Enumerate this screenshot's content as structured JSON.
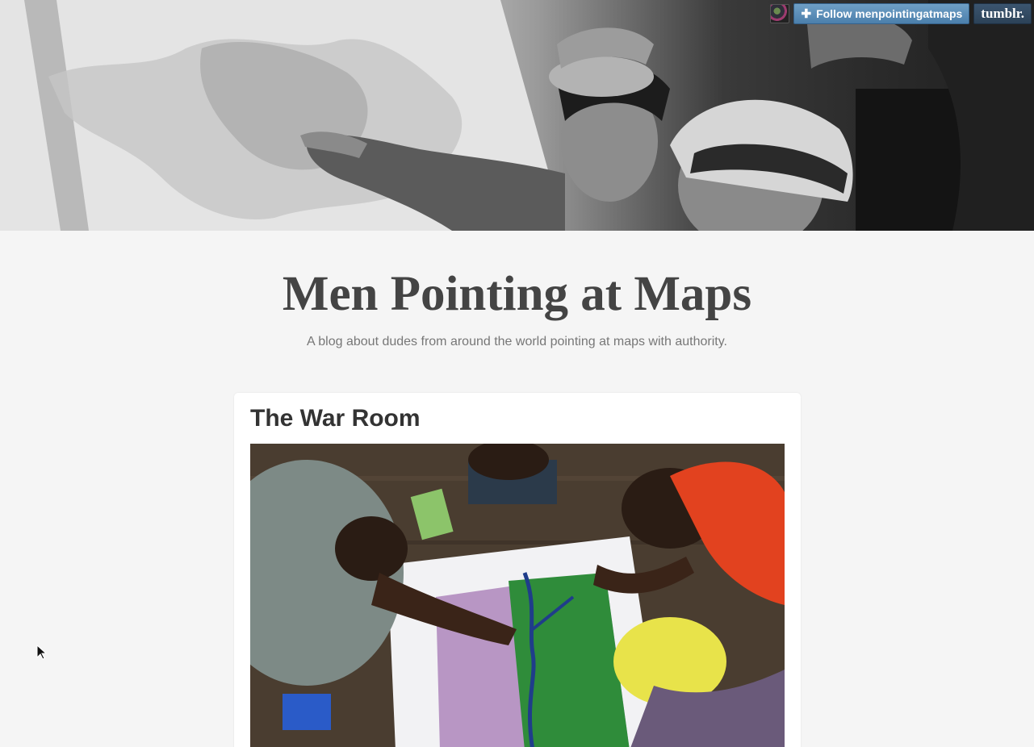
{
  "header": {
    "follow_label": "Follow menpointingatmaps",
    "logo_text": "tumblr."
  },
  "blog": {
    "title": "Men Pointing at Maps",
    "description": "A blog about dudes from around the world pointing at maps with authority."
  },
  "post": {
    "title": "The War Room"
  },
  "icons": {
    "follow": "plus-icon",
    "logo": "tumblr-logo",
    "cursor": "mouse-pointer-icon"
  },
  "colors": {
    "background": "#f5f5f5",
    "follow_button": "#5a8cb8",
    "tumblr_logo": "#34506b",
    "title_text": "#444444"
  }
}
